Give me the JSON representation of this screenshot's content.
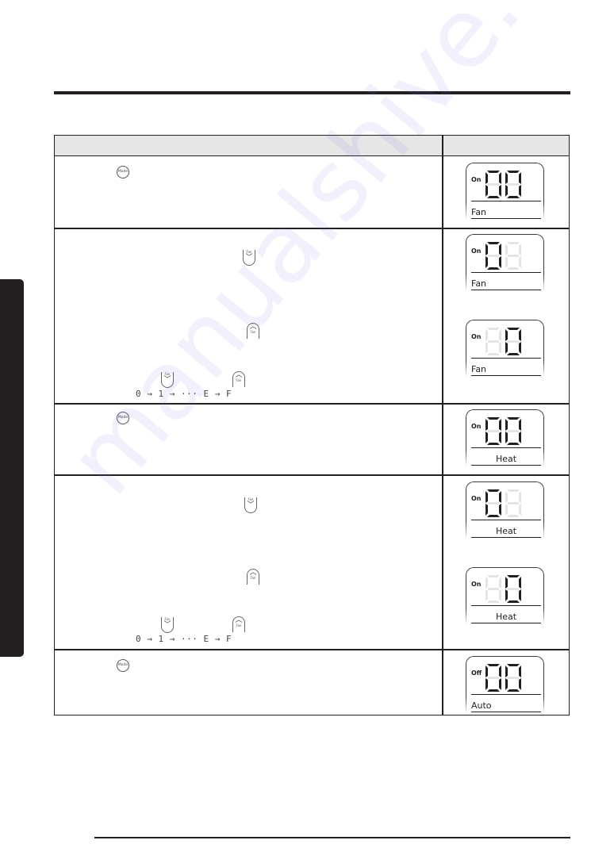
{
  "watermark": "manualshive.com",
  "table": {
    "header": {
      "col1": "",
      "col2": ""
    },
    "rows": [
      {
        "icons": [
          "mode-button"
        ],
        "displays": [
          {
            "state": "On",
            "digits": [
              "0",
              "0"
            ],
            "label": "Fan",
            "label_align": "left"
          }
        ]
      },
      {
        "icons": [
          "fan-down-button",
          "fan-up-button",
          "fan-down-button",
          "fan-up-button"
        ],
        "sequence": "0 → 1 → ··· E → F",
        "displays": [
          {
            "state": "On",
            "digits": [
              "0",
              "off"
            ],
            "label": "Fan",
            "label_align": "left"
          },
          {
            "state": "On",
            "digits": [
              "off",
              "0"
            ],
            "label": "Fan",
            "label_align": "left"
          }
        ]
      },
      {
        "icons": [
          "mode-button"
        ],
        "displays": [
          {
            "state": "On",
            "digits": [
              "0",
              "0"
            ],
            "label": "Heat",
            "label_align": "center"
          }
        ]
      },
      {
        "icons": [
          "fan-down-button",
          "fan-up-button",
          "fan-down-button",
          "fan-up-button"
        ],
        "sequence": "0 → 1 → ··· E → F",
        "displays": [
          {
            "state": "On",
            "digits": [
              "0",
              "off"
            ],
            "label": "Heat",
            "label_align": "center"
          },
          {
            "state": "On",
            "digits": [
              "off",
              "0"
            ],
            "label": "Heat",
            "label_align": "center"
          }
        ]
      },
      {
        "icons": [
          "mode-button"
        ],
        "displays": [
          {
            "state": "Off",
            "digits": [
              "0",
              "0"
            ],
            "label": "Auto",
            "label_align": "left"
          }
        ]
      }
    ]
  },
  "buttons": {
    "mode_label": "Mode",
    "fan_label": "Fan",
    "down_glyph": "﹀",
    "up_glyph": "︿"
  },
  "colors": {
    "ink": "#231f20",
    "header_fill": "#e6e6e7",
    "segment_off": "#e4e4e4"
  }
}
